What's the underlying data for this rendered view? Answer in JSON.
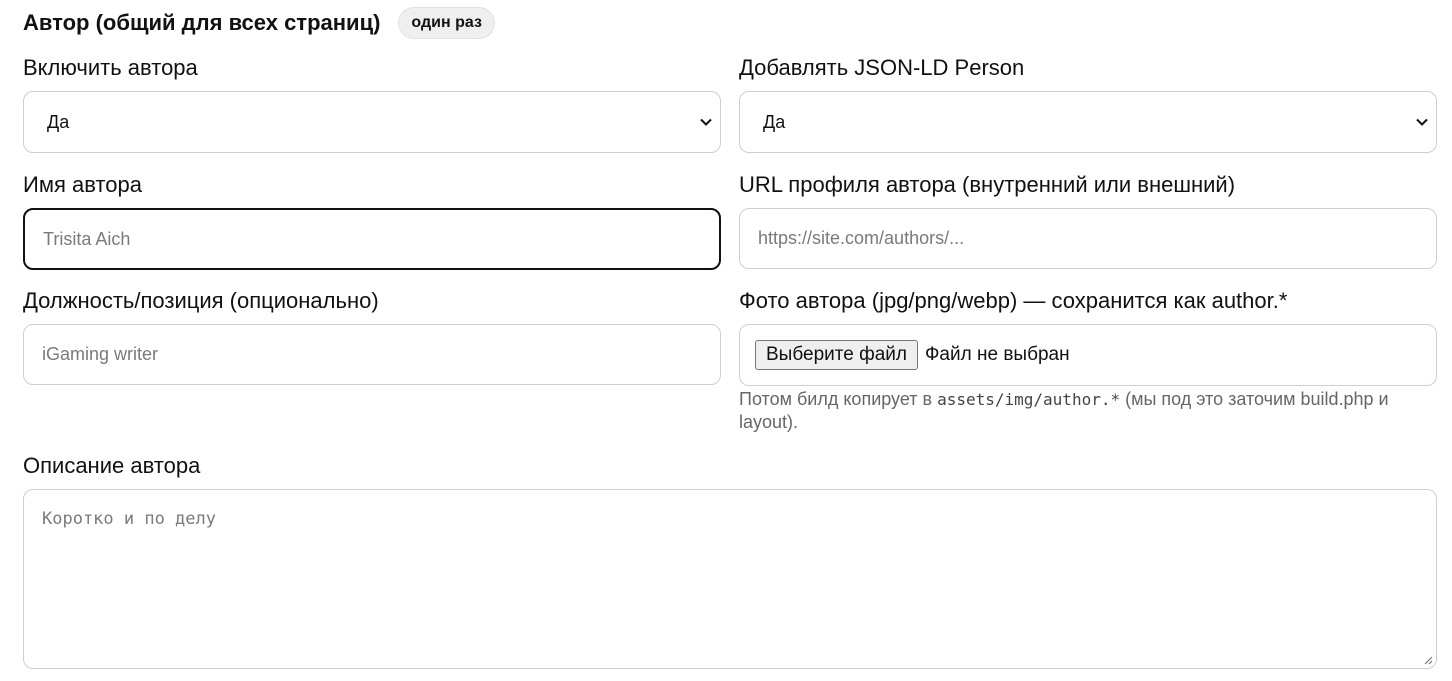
{
  "section": {
    "title": "Автор (общий для всех страниц)",
    "badge": "один раз"
  },
  "fields": {
    "enable_author": {
      "label": "Включить автора",
      "value": "Да"
    },
    "jsonld_person": {
      "label": "Добавлять JSON-LD Person",
      "value": "Да"
    },
    "author_name": {
      "label": "Имя автора",
      "placeholder": "Trisita Aich"
    },
    "author_url": {
      "label": "URL профиля автора (внутренний или внешний)",
      "placeholder": "https://site.com/authors/..."
    },
    "author_position": {
      "label": "Должность/позиция (опционально)",
      "placeholder": "iGaming writer"
    },
    "author_photo": {
      "label": "Фото автора (jpg/png/webp) — сохранится как author.*",
      "button": "Выберите файл",
      "status": "Файл не выбран",
      "hint_prefix": "Потом билд копирует в ",
      "hint_code": "assets/img/author.*",
      "hint_suffix": " (мы под это заточим build.php и layout)."
    },
    "author_description": {
      "label": "Описание автора",
      "placeholder": "Коротко и по делу"
    }
  },
  "icons": {
    "select_arrow": "chevron-down-icon",
    "resize_grip": "resize-grip-icon"
  }
}
